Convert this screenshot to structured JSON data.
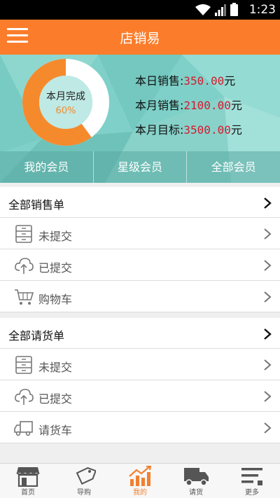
{
  "status_bar": {
    "time": "1:23"
  },
  "app_bar": {
    "title": "店销易"
  },
  "progress": {
    "line1": "本月完成",
    "percent_text": "60%",
    "value": 0.6
  },
  "stats": [
    {
      "label": "本日销售:",
      "value": "350.00",
      "unit": "元"
    },
    {
      "label": "本月销售:",
      "value": "2100.00",
      "unit": "元"
    },
    {
      "label": "本月目标:",
      "value": "3500.00",
      "unit": "元"
    }
  ],
  "member_tabs": [
    "我的会员",
    "星级会员",
    "全部会员"
  ],
  "sales_section": {
    "title": "全部销售单",
    "rows": [
      {
        "label": "未提交",
        "icon": "drawer-icon"
      },
      {
        "label": "已提交",
        "icon": "cloud-upload-icon"
      },
      {
        "label": "购物车",
        "icon": "cart-icon"
      }
    ]
  },
  "purchase_section": {
    "title": "全部请货单",
    "rows": [
      {
        "label": "未提交",
        "icon": "drawer-icon"
      },
      {
        "label": "已提交",
        "icon": "cloud-upload-icon"
      },
      {
        "label": "请货车",
        "icon": "truck-icon"
      }
    ]
  },
  "bottom_nav": [
    {
      "label": "首页",
      "icon": "store-icon"
    },
    {
      "label": "导购",
      "icon": "tag-icon"
    },
    {
      "label": "我的",
      "icon": "chart-icon",
      "active": true
    },
    {
      "label": "请货",
      "icon": "truck-icon"
    },
    {
      "label": "更多",
      "icon": "more-icon"
    }
  ],
  "colors": {
    "accent": "#fb7d2b",
    "teal": "#7fd0c8",
    "value_red": "#d51a2d"
  }
}
